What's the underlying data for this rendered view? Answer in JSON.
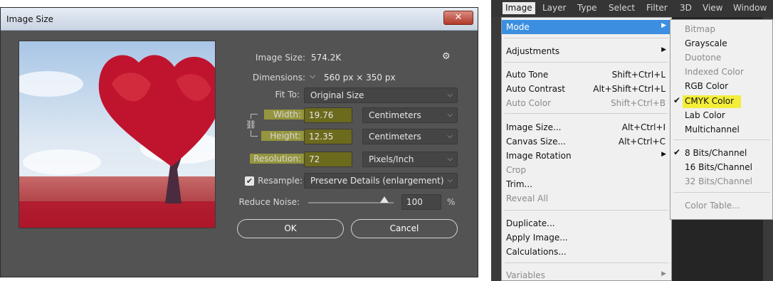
{
  "dialog": {
    "title": "Image Size",
    "close_label": "✕",
    "image_size_label": "Image Size:",
    "image_size_value": "574.2K",
    "dimensions_label": "Dimensions:",
    "dimensions_value": "560 px × 350 px",
    "fit_to_label": "Fit To:",
    "fit_to_value": "Original Size",
    "width_label": "Width:",
    "width_value": "19.76",
    "width_unit": "Centimeters",
    "height_label": "Height:",
    "height_value": "12.35",
    "height_unit": "Centimeters",
    "resolution_label": "Resolution:",
    "resolution_value": "72",
    "resolution_unit": "Pixels/Inch",
    "resample_label": "Resample:",
    "resample_value": "Preserve Details (enlargement)",
    "reduce_noise_label": "Reduce Noise:",
    "reduce_noise_value": "100",
    "reduce_noise_unit": "%",
    "reduce_noise_level": 0.89,
    "ok_label": "OK",
    "cancel_label": "Cancel"
  },
  "menubar": {
    "items": [
      "Image",
      "Layer",
      "Type",
      "Select",
      "Filter",
      "3D",
      "View",
      "Window"
    ]
  },
  "image_menu": {
    "items": [
      {
        "label": "Mode",
        "shortcut": "",
        "submenu": true,
        "state": "selected"
      },
      {
        "label": "Adjustments",
        "shortcut": "",
        "submenu": true,
        "state": "normal"
      },
      {
        "label": "Auto Tone",
        "shortcut": "Shift+Ctrl+L",
        "submenu": false,
        "state": "normal"
      },
      {
        "label": "Auto Contrast",
        "shortcut": "Alt+Shift+Ctrl+L",
        "submenu": false,
        "state": "normal"
      },
      {
        "label": "Auto Color",
        "shortcut": "Shift+Ctrl+B",
        "submenu": false,
        "state": "disabled"
      },
      {
        "label": "Image Size...",
        "shortcut": "Alt+Ctrl+I",
        "submenu": false,
        "state": "normal"
      },
      {
        "label": "Canvas Size...",
        "shortcut": "Alt+Ctrl+C",
        "submenu": false,
        "state": "normal"
      },
      {
        "label": "Image Rotation",
        "shortcut": "",
        "submenu": true,
        "state": "normal"
      },
      {
        "label": "Crop",
        "shortcut": "",
        "submenu": false,
        "state": "disabled"
      },
      {
        "label": "Trim...",
        "shortcut": "",
        "submenu": false,
        "state": "normal"
      },
      {
        "label": "Reveal All",
        "shortcut": "",
        "submenu": false,
        "state": "disabled"
      },
      {
        "label": "Duplicate...",
        "shortcut": "",
        "submenu": false,
        "state": "normal"
      },
      {
        "label": "Apply Image...",
        "shortcut": "",
        "submenu": false,
        "state": "normal"
      },
      {
        "label": "Calculations...",
        "shortcut": "",
        "submenu": false,
        "state": "normal"
      },
      {
        "label": "Variables",
        "shortcut": "",
        "submenu": true,
        "state": "disabled"
      }
    ]
  },
  "mode_submenu": {
    "items": [
      {
        "label": "Bitmap",
        "state": "disabled",
        "checked": false
      },
      {
        "label": "Grayscale",
        "state": "normal",
        "checked": false
      },
      {
        "label": "Duotone",
        "state": "disabled",
        "checked": false
      },
      {
        "label": "Indexed Color",
        "state": "disabled",
        "checked": false
      },
      {
        "label": "RGB Color",
        "state": "normal",
        "checked": false
      },
      {
        "label": "CMYK Color",
        "state": "normal",
        "checked": true,
        "highlight": "#f2ee3a"
      },
      {
        "label": "Lab Color",
        "state": "normal",
        "checked": false
      },
      {
        "label": "Multichannel",
        "state": "normal",
        "checked": false
      },
      {
        "label": "8 Bits/Channel",
        "state": "normal",
        "checked": true
      },
      {
        "label": "16 Bits/Channel",
        "state": "normal",
        "checked": false
      },
      {
        "label": "32 Bits/Channel",
        "state": "disabled",
        "checked": false
      },
      {
        "label": "Color Table...",
        "state": "disabled",
        "checked": false
      }
    ]
  },
  "colors": {
    "dialog_bg": "#535353",
    "highlight_yellow": "#f2ee3a",
    "menu_selected": "#3c8fe0"
  },
  "icons": {
    "gear": "gear-icon",
    "link": "link-icon",
    "checkmark": "checkmark-icon",
    "submenu_arrow": "triangle-right-icon"
  }
}
